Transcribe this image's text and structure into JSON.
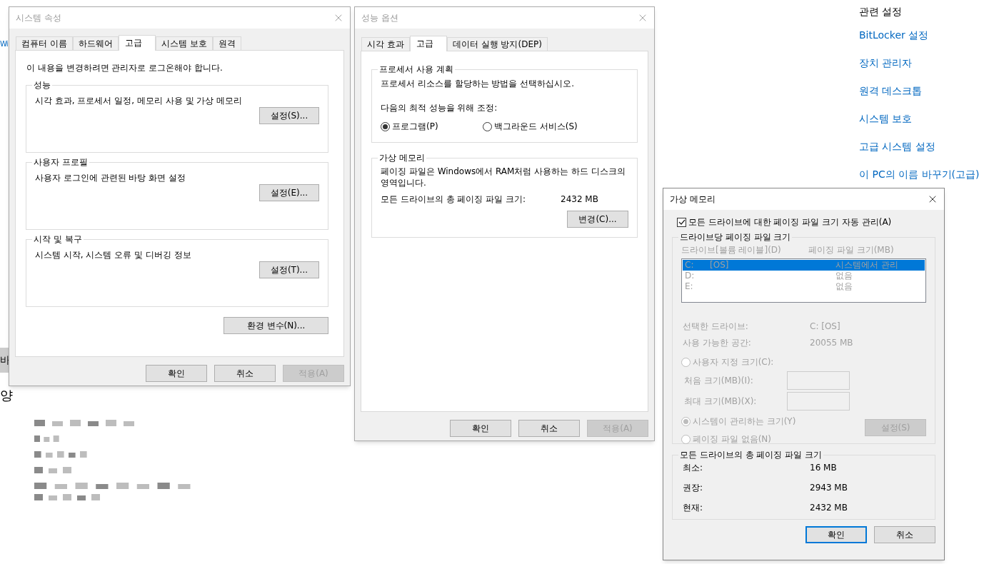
{
  "background": {
    "left_fragments": [
      {
        "text": "Wi",
        "kind": "link"
      },
      {
        "text": "바",
        "kind": "button"
      },
      {
        "text": "양",
        "kind": "heading"
      }
    ],
    "related_settings": {
      "heading": "관련 설정",
      "links": [
        "BitLocker 설정",
        "장치 관리자",
        "원격 데스크톱",
        "시스템 보호",
        "고급 시스템 설정",
        "이 PC의 이름 바꾸기(고급)"
      ]
    }
  },
  "system_properties": {
    "title": "시스템 속성",
    "active": false,
    "tabs": [
      {
        "label": "컴퓨터 이름",
        "selected": false
      },
      {
        "label": "하드웨어",
        "selected": false
      },
      {
        "label": "고급",
        "selected": true
      },
      {
        "label": "시스템 보호",
        "selected": false
      },
      {
        "label": "원격",
        "selected": false
      }
    ],
    "notice": "이 내용을 변경하려면 관리자로 로그온해야 합니다.",
    "groups": [
      {
        "title": "성능",
        "description": "시각 효과, 프로세서 일정, 메모리 사용 및 가상 메모리",
        "button": "설정(S)..."
      },
      {
        "title": "사용자 프로필",
        "description": "사용자 로그인에 관련된 바탕 화면 설정",
        "button": "설정(E)..."
      },
      {
        "title": "시작 및 복구",
        "description": "시스템 시작, 시스템 오류 및 디버깅 정보",
        "button": "설정(T)..."
      }
    ],
    "env_button": "환경 변수(N)...",
    "buttons": [
      {
        "label": "확인",
        "disabled": false
      },
      {
        "label": "취소",
        "disabled": false
      },
      {
        "label": "적용(A)",
        "disabled": true
      }
    ]
  },
  "performance_options": {
    "title": "성능 옵션",
    "active": false,
    "tabs": [
      {
        "label": "시각 효과",
        "selected": false
      },
      {
        "label": "고급",
        "selected": true
      },
      {
        "label": "데이터 실행 방지(DEP)",
        "selected": false
      }
    ],
    "processor": {
      "title": "프로세서 사용 계획",
      "description": "프로세서 리소스를 할당하는 방법을 선택하십시오.",
      "adjust_label": "다음의 최적 성능을 위해 조정:",
      "options": [
        {
          "label": "프로그램(P)",
          "selected": true
        },
        {
          "label": "백그라운드 서비스(S)",
          "selected": false
        }
      ]
    },
    "virtual_memory": {
      "title": "가상 메모리",
      "description": "페이징 파일은 Windows에서 RAM처럼 사용하는 하드 디스크의 영역입니다.",
      "total_label": "모든 드라이브의 총 페이징 파일 크기:",
      "total_value": "2432 MB",
      "button": "변경(C)..."
    },
    "buttons": [
      {
        "label": "확인",
        "disabled": false
      },
      {
        "label": "취소",
        "disabled": false
      },
      {
        "label": "적용(A)",
        "disabled": true
      }
    ]
  },
  "virtual_memory": {
    "title": "가상 메모리",
    "active": true,
    "auto_manage": {
      "label": "모든 드라이브에 대한 페이징 파일 크기 자동 관리(A)",
      "checked": true
    },
    "per_drive": {
      "title": "드라이브당 페이징 파일 크기",
      "disabled": true,
      "columns": [
        "드라이브[볼륨 레이블](D)",
        "페이징 파일 크기(MB)"
      ],
      "drives": [
        {
          "drive": "C:",
          "label": "[OS]",
          "size": "시스템에서 관리",
          "selected": true
        },
        {
          "drive": "D:",
          "size": "없음",
          "selected": false
        },
        {
          "drive": "E:",
          "size": "없음",
          "selected": false
        }
      ],
      "selected_drive_label": "선택한 드라이브:",
      "selected_drive_value": "C:  [OS]",
      "free_space_label": "사용 가능한 공간:",
      "free_space_value": "20055 MB",
      "custom_size": {
        "label": "사용자 지정 크기(C):",
        "selected": false
      },
      "size_fields": [
        "처음 크기(MB)(I):",
        "최대 크기(MB)(X):"
      ],
      "system_managed": {
        "label": "시스템이 관리하는 크기(Y)",
        "selected": true
      },
      "no_paging": {
        "label": "페이징 파일 없음(N)",
        "selected": false
      },
      "set_button": {
        "label": "설정(S)",
        "disabled": true
      }
    },
    "totals": {
      "title": "모든 드라이브의 총 페이징 파일 크기",
      "rows": [
        {
          "label": "최소:",
          "value": "16 MB"
        },
        {
          "label": "권장:",
          "value": "2943 MB"
        },
        {
          "label": "현재:",
          "value": "2432 MB"
        }
      ]
    },
    "buttons": [
      {
        "label": "확인",
        "default": true
      },
      {
        "label": "취소",
        "default": false
      }
    ]
  }
}
